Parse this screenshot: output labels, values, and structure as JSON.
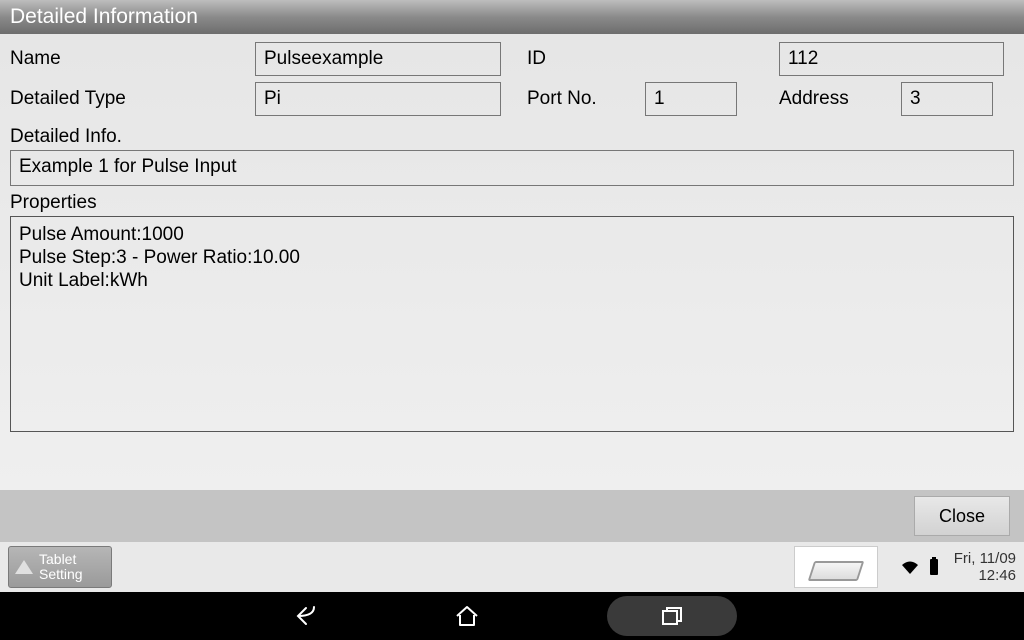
{
  "title": "Detailed Information",
  "fields": {
    "name_label": "Name",
    "name_value": "Pulseexample",
    "id_label": "ID",
    "id_value": "112",
    "type_label": "Detailed Type",
    "type_value": "Pi",
    "port_label": "Port No.",
    "port_value": "1",
    "address_label": "Address",
    "address_value": "3"
  },
  "detailed_info_label": "Detailed Info.",
  "detailed_info_value": "Example 1 for Pulse Input",
  "properties_label": "Properties",
  "properties_text": "Pulse Amount:1000\nPulse Step:3 - Power Ratio:10.00\nUnit Label:kWh",
  "buttons": {
    "close": "Close",
    "tablet_setting": "Tablet\nSetting"
  },
  "status": {
    "date": "Fri, 11/09",
    "time": "12:46"
  }
}
